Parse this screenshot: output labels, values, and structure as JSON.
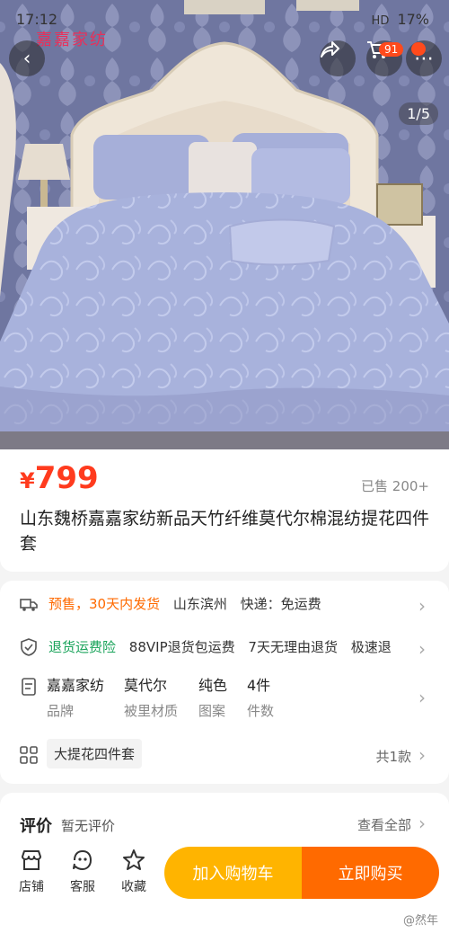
{
  "status_bar": {
    "time": "17:12",
    "network": "HD",
    "battery": "17%"
  },
  "shop_watermark": "嘉嘉家纺",
  "nav": {
    "cart_badge": "91",
    "more_badge": ""
  },
  "gallery": {
    "pager": "1/5"
  },
  "product": {
    "currency": "¥",
    "price": "799",
    "sold": "已售 200+",
    "title": "山东魏桥嘉嘉家纺新品天竹纤维莫代尔棉混纺提花四件套"
  },
  "shipping": {
    "presale": "预售，30天内发货",
    "origin": "山东滨州",
    "fee": "快递：免运费"
  },
  "guarantee": {
    "label": "退货运费险",
    "items": [
      "88VIP退货包运费",
      "7天无理由退货",
      "极速退"
    ]
  },
  "specs": [
    {
      "value": "嘉嘉家纺",
      "key": "品牌"
    },
    {
      "value": "莫代尔",
      "key": "被里材质"
    },
    {
      "value": "纯色",
      "key": "图案"
    },
    {
      "value": "4件",
      "key": "件数"
    }
  ],
  "sku": {
    "selected": "大提花四件套",
    "count": "共1款"
  },
  "reviews": {
    "title": "评价",
    "empty": "暂无评价",
    "view_all": "查看全部"
  },
  "bottom_tabs": [
    {
      "label": "店铺",
      "icon": "store-icon"
    },
    {
      "label": "客服",
      "icon": "customer-service-icon"
    },
    {
      "label": "收藏",
      "icon": "star-icon"
    }
  ],
  "actions": {
    "add_to_cart": "加入购物车",
    "buy_now": "立即购买"
  },
  "watermark": "@然年",
  "colors": {
    "price": "#ff3b1e",
    "cart_button": "#ffb400",
    "buy_button": "#ff6a00",
    "badge": "#ff4a1c"
  }
}
